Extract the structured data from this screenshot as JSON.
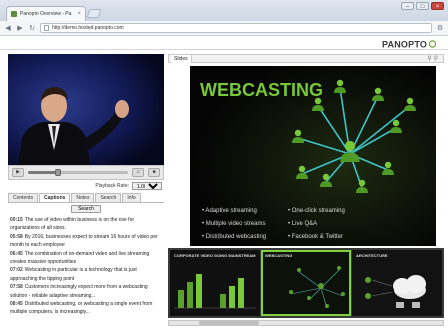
{
  "browser": {
    "tab_title": "Panopto Overview - Pa",
    "tab_close": "×",
    "url": "http://demo.hosted.panopto.com",
    "back_icon": "arrow-left-icon",
    "forward_icon": "arrow-right-icon",
    "reload_icon": "reload-icon",
    "wrench_icon": "wrench-icon",
    "window_buttons": [
      "–",
      "□",
      "×"
    ]
  },
  "header": {
    "logo_main": "PANOPTO"
  },
  "player": {
    "play_icon": "play-icon",
    "progress": 0.3,
    "playback_rate_label": "Playback Rate:",
    "playback_rate_value": "1.00x (normal)"
  },
  "tabs": [
    "Contents",
    "Captions",
    "Notes",
    "Search",
    "Info"
  ],
  "active_tab": "Captions",
  "search_button": "Search",
  "captions": [
    {
      "time": "00:15",
      "text": "The use of video within business is on the rise for organizations of all sizes."
    },
    {
      "time": "05:58",
      "text": "By 2016, businesses expect to stream 16 hours of video per month to each employee"
    },
    {
      "time": "06:45",
      "text": "The combination of on-demand video and live streaming creates massive opportunities"
    },
    {
      "time": "07:02",
      "text": "Webcasting in particular is a technology that is just approaching the tipping point"
    },
    {
      "time": "07:58",
      "text": "Customers increasingly expect more from a webcasting solution - reliable adaptive streaming..."
    },
    {
      "time": "08:45",
      "text": "Distributed webcasting, or webcasting a single event from multiple computers, is increasingly..."
    }
  ],
  "slides_tab": "Slides",
  "slide": {
    "title": "WEBCASTING",
    "bullets_left": [
      "Adaptive streaming",
      "Multiple video streams",
      "Distributed webcasting"
    ],
    "bullets_right": [
      "One-click streaming",
      "Live Q&A",
      "Facebook & Twitter"
    ],
    "accent_color": "#79c83a"
  },
  "thumbnails": [
    {
      "label": "CORPORATE VIDEO GOING MAINSTREAM"
    },
    {
      "label": "WEBCASTING"
    },
    {
      "label": "ARCHITECTURE"
    }
  ]
}
